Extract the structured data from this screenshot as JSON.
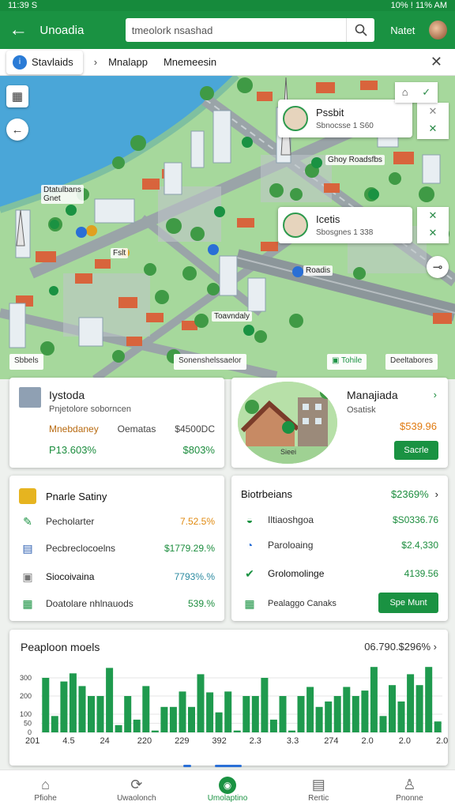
{
  "status": {
    "time": "11:39 S",
    "right": "10% ! 11% AM"
  },
  "appbar": {
    "back": "←",
    "title": "Unoadia",
    "search_placeholder": "tmeolork nsashad",
    "search_icon": "search-icon",
    "next": "Natet",
    "avatar": "avatar"
  },
  "breadcrumb": {
    "home": "Stavlaids",
    "home_icon_letter": "i",
    "sep": "›",
    "item1": "Mnalapp",
    "item2": "Mnemeesin",
    "close": "✕"
  },
  "map": {
    "labels": {
      "poi1": "Dtatulbans",
      "poi1b": "Gnet",
      "poi2": "Ghoy Roadsfbs",
      "poi3": "Roadis",
      "poi4": "Toavndaly",
      "poi5": "Fslt",
      "foot_left": "Sbbels",
      "foot_mid": "Sonenshelssaelor",
      "foot_badge": "Tohile",
      "foot_right": "Deeltabores"
    },
    "card1": {
      "title": "Pssbit",
      "sub": "Sbnocsse  1 S60"
    },
    "card2": {
      "title": "Icetis",
      "sub": "Sbosgnes  1 338"
    }
  },
  "property": {
    "title": "Iystoda",
    "sub": "Pnjetolore soborncen",
    "r1_a": "Mnebdaney",
    "r1_b": "Oematas",
    "r1_c": "$4500DC",
    "r2_a": "P13.603%",
    "r2_b": "$803%"
  },
  "management": {
    "title": "Manajiada",
    "sub": "Osatisk",
    "price": "$539.96",
    "button": "Sacrle",
    "chev": "›",
    "pin": "Sieei"
  },
  "left_list": {
    "head": {
      "label": "Pnarle Satiny"
    },
    "rows": [
      {
        "label": "Pecholarter",
        "value": "7.52.5%",
        "color": "#e08a10"
      },
      {
        "label": "Pecbreclocoelns",
        "value": "$1779.29.%",
        "color": "#1c8d3e"
      },
      {
        "label": "Siocoivaina",
        "value": "7793%.%",
        "color": "#2a8aa0"
      },
      {
        "label": "Doatolare nhlnauods",
        "value": "539.%",
        "color": "#1c8d3e"
      }
    ]
  },
  "right_list": {
    "head": {
      "label": "Biotrbeians",
      "value": "$2369%"
    },
    "rows": [
      {
        "label": "Iltiaoshgoa",
        "value": "$S0336.76"
      },
      {
        "label": "Paroloaing",
        "value": "$2.4,330"
      },
      {
        "label": "Grolomolinge",
        "value": "4139.56"
      },
      {
        "label": "Pealaggo Canaks",
        "value": ""
      }
    ],
    "button": "Spe Munt",
    "chev": "›"
  },
  "chart_data": {
    "type": "bar",
    "title": "Peaploon moels",
    "summary": "06.790.$296%",
    "ylabel": "",
    "ylim": [
      0,
      400
    ],
    "yticks": [
      0,
      50,
      100,
      200,
      300
    ],
    "ytick_labels": [
      "0",
      "50",
      "100",
      "200",
      "300"
    ],
    "xtick_labels": [
      "201",
      "4.5",
      "24",
      "220",
      "229",
      "392",
      "2.3",
      "3.3",
      "274",
      "2.0",
      "2.0",
      "2.0"
    ],
    "values": [
      300,
      90,
      280,
      325,
      255,
      200,
      200,
      355,
      40,
      200,
      70,
      255,
      10,
      140,
      140,
      225,
      140,
      320,
      220,
      110,
      225,
      10,
      200,
      200,
      300,
      70,
      200,
      10,
      200,
      250,
      140,
      170,
      200,
      250,
      200,
      230,
      360,
      90,
      260,
      170,
      320,
      260,
      360,
      60
    ]
  },
  "tabs": [
    {
      "label": "Pfiohe",
      "icon": "home-icon",
      "glyph": "⌂"
    },
    {
      "label": "Uwaolonch",
      "icon": "refresh-icon",
      "glyph": "⟳"
    },
    {
      "label": "Umolaptino",
      "icon": "location-icon",
      "glyph": "◉"
    },
    {
      "label": "Rertic",
      "icon": "document-icon",
      "glyph": "▤"
    },
    {
      "label": "Pnonne",
      "icon": "user-icon",
      "glyph": "♙"
    }
  ],
  "colors": {
    "brand": "#1a9242",
    "accent_orange": "#e07a10",
    "water": "#4aa6d8",
    "road": "#9aa4a8"
  }
}
